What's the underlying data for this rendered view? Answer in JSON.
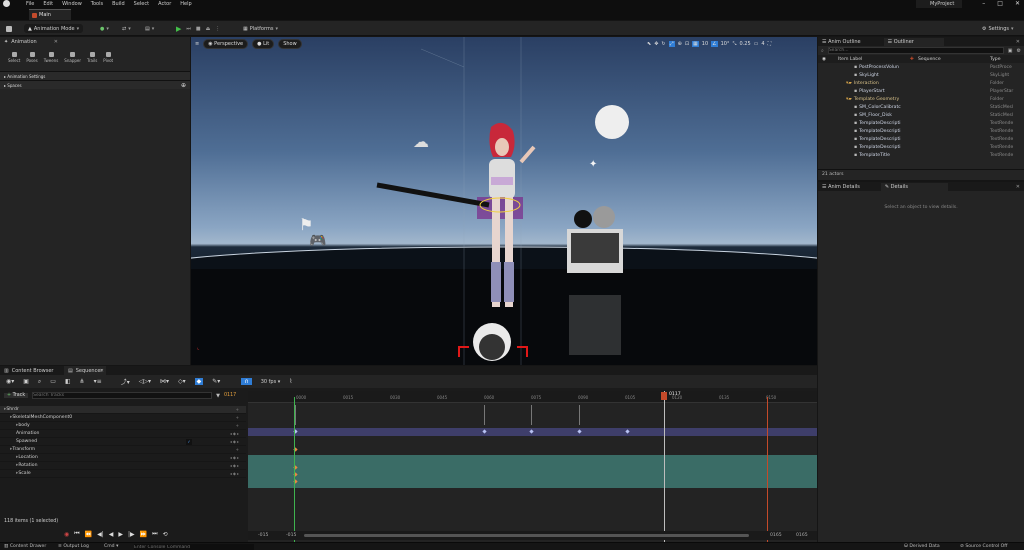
{
  "menu": [
    "File",
    "Edit",
    "Window",
    "Tools",
    "Build",
    "Select",
    "Actor",
    "Help"
  ],
  "project_name": "MyProject",
  "level_tab": "Main",
  "toolbar": {
    "mode": "Animation Mode",
    "platforms": "Platforms",
    "settings": "Settings"
  },
  "animation_panel": {
    "tab": "Animation",
    "tools": [
      "Select",
      "Poses",
      "Tweens",
      "Snapper",
      "Trails",
      "Pivot"
    ],
    "sections": [
      "Animation Settings",
      "Spaces"
    ]
  },
  "viewport": {
    "perspective": "Perspective",
    "lit": "Lit",
    "show": "Show",
    "grid_size": "10",
    "rotation_snap": "10°",
    "scale_snap": "0.25",
    "camera_speed": "4"
  },
  "outliner": {
    "tabs": [
      "Anim Outline",
      "Outliner"
    ],
    "search_placeholder": "Search...",
    "columns": [
      "Item Label",
      "Sequence",
      "Type"
    ],
    "rows": [
      {
        "label": "PostProcessVolun",
        "type": "PostProce",
        "depth": 2
      },
      {
        "label": "SkyLight",
        "type": "SkyLight",
        "depth": 2
      },
      {
        "label": "Interaction",
        "type": "Folder",
        "depth": 1
      },
      {
        "label": "PlayerStart",
        "type": "PlayerStar",
        "depth": 2
      },
      {
        "label": "Template Geometry",
        "type": "Folder",
        "depth": 1
      },
      {
        "label": "SM_ColorCalibratc",
        "type": "StaticMesl",
        "depth": 2
      },
      {
        "label": "SM_Floor_Disk",
        "type": "StaticMesl",
        "depth": 2
      },
      {
        "label": "TemplateDescripti",
        "type": "TextRende",
        "depth": 2
      },
      {
        "label": "TemplateDescripti",
        "type": "TextRende",
        "depth": 2
      },
      {
        "label": "TemplateDescripti",
        "type": "TextRende",
        "depth": 2
      },
      {
        "label": "TemplateDescripti",
        "type": "TextRende",
        "depth": 2
      },
      {
        "label": "TemplateTitle",
        "type": "TextRende",
        "depth": 2
      }
    ],
    "actor_count": "21 actors"
  },
  "details": {
    "tabs": [
      "Anim Details",
      "Details"
    ],
    "empty_message": "Select an object to view details."
  },
  "bottom_tabs": [
    "Content Browser",
    "Sequencer"
  ],
  "sequencer": {
    "add_track": "Track",
    "search_placeholder": "Search Tracks",
    "current_frame": "0117",
    "fps": "30 fps",
    "tracks": [
      {
        "label": "Shrdr",
        "depth": 0
      },
      {
        "label": "SkeletalMeshComponent0",
        "depth": 1
      },
      {
        "label": "body",
        "depth": 2
      },
      {
        "label": "Animation",
        "depth": 2
      },
      {
        "label": "Spawned",
        "depth": 2
      },
      {
        "label": "Transform",
        "depth": 1
      },
      {
        "label": "Location",
        "depth": 2
      },
      {
        "label": "Rotation",
        "depth": 2
      },
      {
        "label": "Scale",
        "depth": 2
      }
    ],
    "items_status": "118 items (1 selected)",
    "ruler": [
      "0000",
      "0015",
      "0030",
      "0045",
      "0060",
      "0075",
      "0090",
      "0105",
      "0120",
      "0135",
      "0150"
    ],
    "playhead": "0117",
    "range_left": [
      "-015",
      "-015"
    ],
    "range_right": [
      "0165",
      "0165"
    ]
  },
  "statusbar": {
    "content_drawer": "Content Drawer",
    "output_log": "Output Log",
    "cmd": "Cmd",
    "console_placeholder": "Enter Console Command",
    "derived_data": "Derived Data",
    "source_control": "Source Control Off"
  },
  "colors": {
    "play": "#44c04a",
    "accent": "#2f7dd6",
    "playhead": "#c44a2a",
    "track_band": "#3a6c66",
    "body_band": "#3e3e6a"
  }
}
